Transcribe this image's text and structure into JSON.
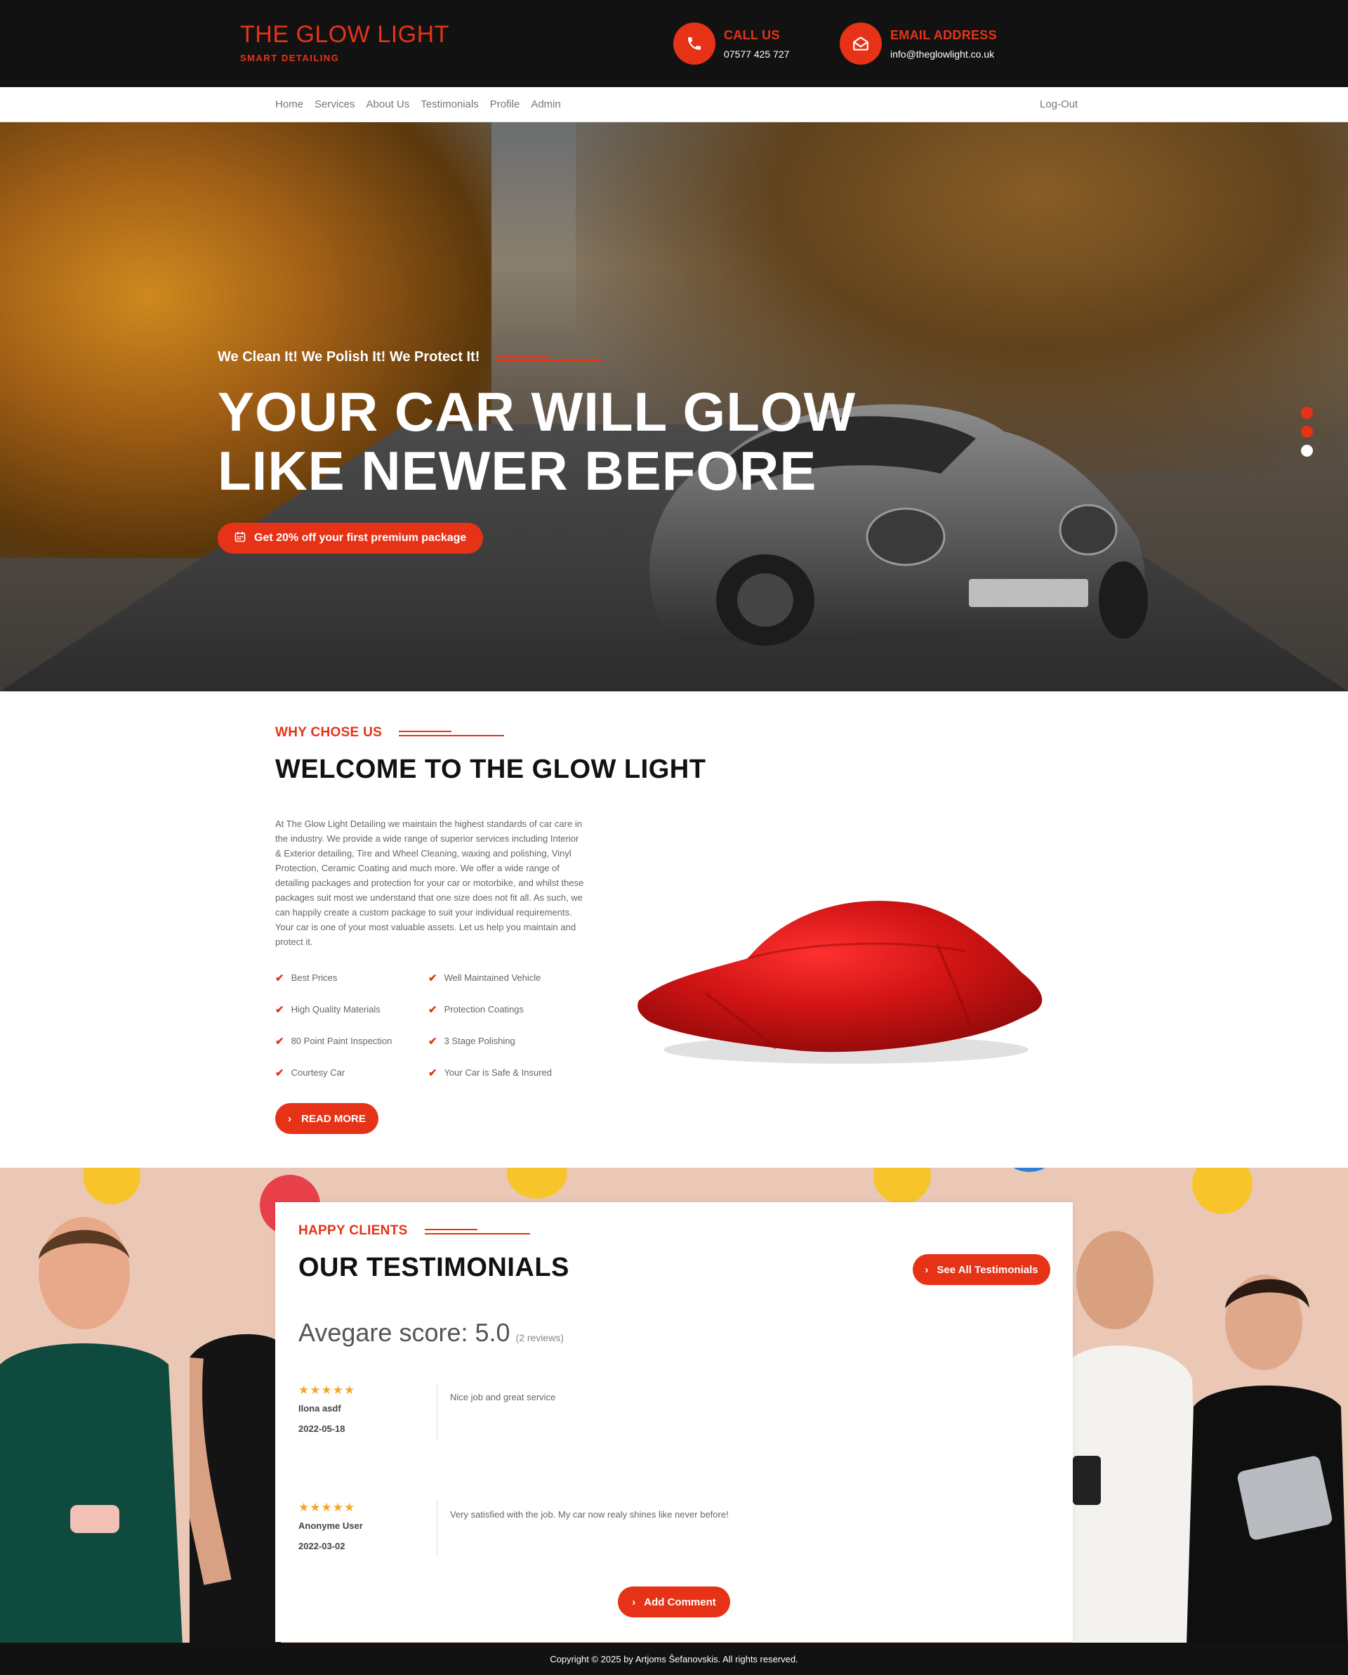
{
  "header": {
    "brand_name": "THE GLOW LIGHT",
    "brand_tagline": "SMART DETAILING",
    "call_label": "CALL US",
    "call_value": "07577 425 727",
    "email_label": "EMAIL ADDRESS",
    "email_value": "info@theglowlight.co.uk"
  },
  "nav": {
    "items": [
      "Home",
      "Services",
      "About Us",
      "Testimonials",
      "Profile",
      "Admin"
    ],
    "logout": "Log-Out"
  },
  "hero": {
    "tagline": "We Clean It! We Polish It! We Protect It!",
    "title_line1": "YOUR CAR WILL GLOW",
    "title_line2": "LIKE NEWER BEFORE",
    "cta": "Get 20% off your first premium package",
    "slides": 3,
    "active_slide": 3
  },
  "about": {
    "eyebrow": "WHY CHOSE US",
    "title": "WELCOME TO THE GLOW LIGHT",
    "text": "At The Glow Light Detailing we maintain the highest standards of car care in the industry. We provide a wide range of superior services including Interior & Exterior detailing, Tire and Wheel Cleaning, waxing and polishing, Vinyl Protection, Ceramic Coating and much more. We offer a wide range of detailing packages and protection for your car or motorbike, and whilst these packages suit most we understand that one size does not fit all. As such, we can happily create a custom package to suit your individual requirements. Your car is one of your most valuable assets. Let us help you maintain and protect it.",
    "features": [
      "Best Prices",
      "Well Maintained Vehicle",
      "High Quality Materials",
      "Protection Coatings",
      "80 Point Paint Inspection",
      "3 Stage Polishing",
      "Courtesy Car",
      "Your Car is Safe & Insured"
    ],
    "read_more": "READ MORE"
  },
  "testimonials": {
    "eyebrow": "HAPPY CLIENTS",
    "title": "OUR TESTIMONIALS",
    "see_all": "See All Testimonials",
    "average_label": "Avegare score: 5.0",
    "review_count": "(2 reviews)",
    "reviews": [
      {
        "stars": "★★★★★",
        "name": "Ilona asdf",
        "date": "2022-05-18",
        "text": "Nice job and great service"
      },
      {
        "stars": "★★★★★",
        "name": "Anonyme User",
        "date": "2022-03-02",
        "text": "Very satisfied with the job. My car now realy shines like never before!"
      }
    ],
    "add_comment": "Add Comment"
  },
  "footer": {
    "copyright": "Copyright © 2025 by Artjoms Šefanovskis. All rights reserved."
  },
  "colors": {
    "accent": "#e63317",
    "dark": "#121212",
    "star": "#f5a623",
    "testimonial_bg": "#ebc8b6"
  }
}
